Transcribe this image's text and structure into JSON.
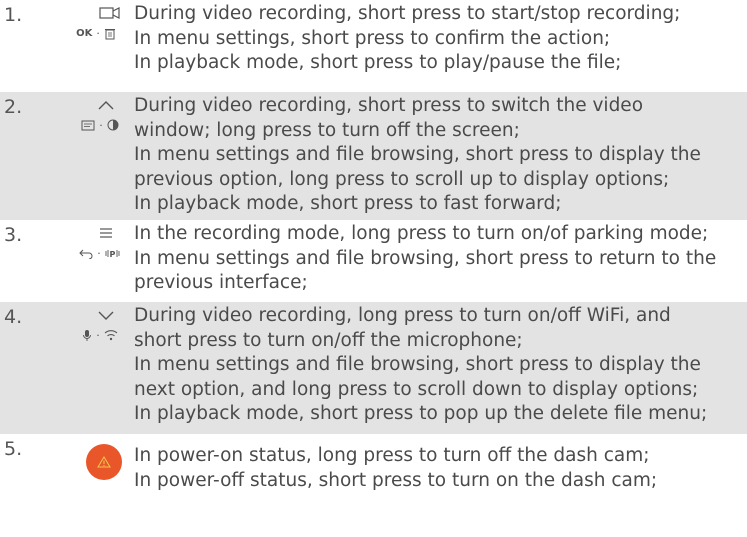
{
  "rows": [
    {
      "number": "1.",
      "icon_top": "video-camera-icon",
      "icon_bottom_text": "OK",
      "icon_bottom": [
        "ok-label",
        "trash-icon"
      ],
      "lines": [
        "During video recording, short press to start/stop recording;",
        "In menu settings, short press to confirm the action;",
        "In playback mode, short press to play/pause the file;"
      ]
    },
    {
      "number": "2.",
      "icon_top": "chevron-up-icon",
      "icon_bottom": [
        "screen-window-icon",
        "brightness-icon"
      ],
      "lines": [
        "During video recording, short press to switch the video",
        "window; long press to turn off the screen;",
        "In menu settings and file browsing, short press to display the",
        "previous option, long press to scroll up to display options;",
        "In playback mode, short press to fast forward;"
      ]
    },
    {
      "number": "3.",
      "icon_top": "menu-icon",
      "icon_bottom": [
        "return-arrow-icon",
        "parking-icon"
      ],
      "lines": [
        "In the recording mode, long press to turn on/of parking mode;",
        "In menu settings and file browsing, short press to return to the",
        "previous interface;"
      ]
    },
    {
      "number": "4.",
      "icon_top": "chevron-down-icon",
      "icon_bottom": [
        "microphone-icon",
        "wifi-icon"
      ],
      "lines": [
        "During video recording, long press to turn on/off WiFi, and",
        "short press to turn on/off the microphone;",
        "In menu settings and file browsing, short press to display the",
        "next option, and long press to scroll down to display options;",
        "In playback mode, short press to pop up the delete file menu;"
      ]
    },
    {
      "number": "5.",
      "icon_top": "emergency-warning-icon",
      "lines": [
        "In power-on status, long press to turn off the dash cam;",
        "In power-off status, short press to turn on the dash cam;"
      ]
    }
  ],
  "colors": {
    "text": "#4a4a4a",
    "shaded_row": "#e3e3e3",
    "emergency_button": "#e8562a"
  }
}
